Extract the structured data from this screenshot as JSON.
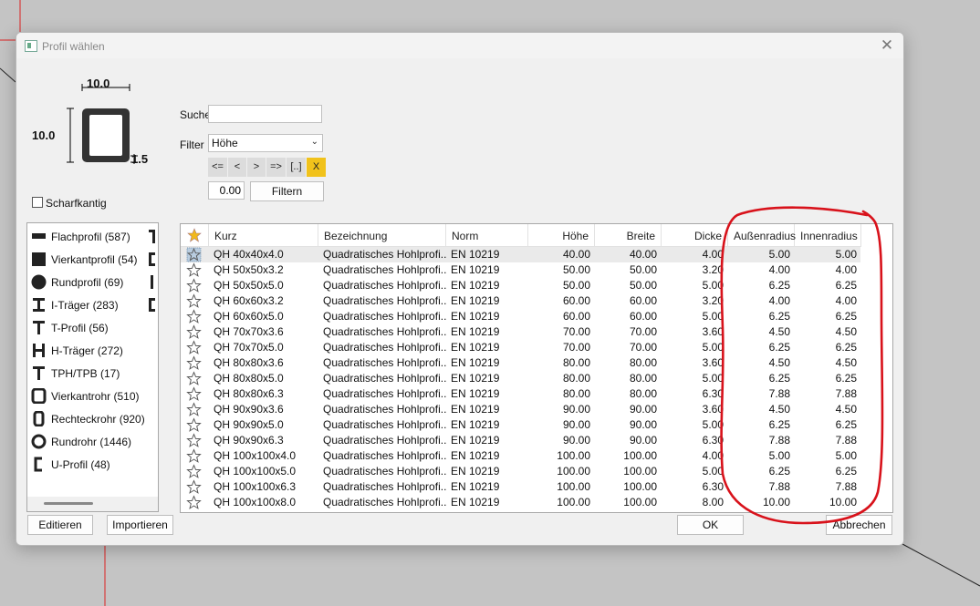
{
  "window": {
    "title": "Profil wählen",
    "close_glyph": "✕"
  },
  "preview": {
    "width": "10.0",
    "height": "10.0",
    "thickness": "1.5"
  },
  "search": {
    "label": "Suche",
    "value": ""
  },
  "filter": {
    "label": "Filter",
    "selected": "Höhe",
    "buttons": [
      "<=",
      "<",
      ">",
      "=>",
      "[..]",
      "X"
    ],
    "value": "0.00",
    "apply_label": "Filtern"
  },
  "sharp_edges": {
    "label": "Scharfkantig",
    "checked": false
  },
  "categories": [
    {
      "label": "Flachprofil (587)",
      "icon": "flat-bar-icon"
    },
    {
      "label": "Vierkantprofil (54)",
      "icon": "square-bar-icon"
    },
    {
      "label": "Rundprofil (69)",
      "icon": "round-bar-icon"
    },
    {
      "label": "I-Träger (283)",
      "icon": "i-beam-icon"
    },
    {
      "label": "T-Profil (56)",
      "icon": "t-profile-icon"
    },
    {
      "label": "H-Träger (272)",
      "icon": "h-beam-icon"
    },
    {
      "label": "TPH/TPB (17)",
      "icon": "tph-icon"
    },
    {
      "label": "Vierkantrohr (510)",
      "icon": "square-tube-icon"
    },
    {
      "label": "Rechteckrohr (920)",
      "icon": "rect-tube-icon"
    },
    {
      "label": "Rundrohr (1446)",
      "icon": "round-tube-icon"
    },
    {
      "label": "U-Profil (48)",
      "icon": "u-profile-icon"
    }
  ],
  "table": {
    "columns": [
      "Kurz",
      "Bezeichnung",
      "Norm",
      "Höhe",
      "Breite",
      "Dicke",
      "Außenradius",
      "Innenradius"
    ],
    "rows": [
      [
        "QH 40x40x4.0",
        "Quadratisches Hohlprofi...",
        "EN 10219",
        "40.00",
        "40.00",
        "4.00",
        "5.00",
        "5.00"
      ],
      [
        "QH 50x50x3.2",
        "Quadratisches Hohlprofi...",
        "EN 10219",
        "50.00",
        "50.00",
        "3.20",
        "4.00",
        "4.00"
      ],
      [
        "QH 50x50x5.0",
        "Quadratisches Hohlprofi...",
        "EN 10219",
        "50.00",
        "50.00",
        "5.00",
        "6.25",
        "6.25"
      ],
      [
        "QH 60x60x3.2",
        "Quadratisches Hohlprofi...",
        "EN 10219",
        "60.00",
        "60.00",
        "3.20",
        "4.00",
        "4.00"
      ],
      [
        "QH 60x60x5.0",
        "Quadratisches Hohlprofi...",
        "EN 10219",
        "60.00",
        "60.00",
        "5.00",
        "6.25",
        "6.25"
      ],
      [
        "QH 70x70x3.6",
        "Quadratisches Hohlprofi...",
        "EN 10219",
        "70.00",
        "70.00",
        "3.60",
        "4.50",
        "4.50"
      ],
      [
        "QH 70x70x5.0",
        "Quadratisches Hohlprofi...",
        "EN 10219",
        "70.00",
        "70.00",
        "5.00",
        "6.25",
        "6.25"
      ],
      [
        "QH 80x80x3.6",
        "Quadratisches Hohlprofi...",
        "EN 10219",
        "80.00",
        "80.00",
        "3.60",
        "4.50",
        "4.50"
      ],
      [
        "QH 80x80x5.0",
        "Quadratisches Hohlprofi...",
        "EN 10219",
        "80.00",
        "80.00",
        "5.00",
        "6.25",
        "6.25"
      ],
      [
        "QH 80x80x6.3",
        "Quadratisches Hohlprofi...",
        "EN 10219",
        "80.00",
        "80.00",
        "6.30",
        "7.88",
        "7.88"
      ],
      [
        "QH 90x90x3.6",
        "Quadratisches Hohlprofi...",
        "EN 10219",
        "90.00",
        "90.00",
        "3.60",
        "4.50",
        "4.50"
      ],
      [
        "QH 90x90x5.0",
        "Quadratisches Hohlprofi...",
        "EN 10219",
        "90.00",
        "90.00",
        "5.00",
        "6.25",
        "6.25"
      ],
      [
        "QH 90x90x6.3",
        "Quadratisches Hohlprofi...",
        "EN 10219",
        "90.00",
        "90.00",
        "6.30",
        "7.88",
        "7.88"
      ],
      [
        "QH 100x100x4.0",
        "Quadratisches Hohlprofi...",
        "EN 10219",
        "100.00",
        "100.00",
        "4.00",
        "5.00",
        "5.00"
      ],
      [
        "QH 100x100x5.0",
        "Quadratisches Hohlprofi...",
        "EN 10219",
        "100.00",
        "100.00",
        "5.00",
        "6.25",
        "6.25"
      ],
      [
        "QH 100x100x6.3",
        "Quadratisches Hohlprofi...",
        "EN 10219",
        "100.00",
        "100.00",
        "6.30",
        "7.88",
        "7.88"
      ],
      [
        "QH 100x100x8.0",
        "Quadratisches Hohlprofi...",
        "EN 10219",
        "100.00",
        "100.00",
        "8.00",
        "10.00",
        "10.00"
      ]
    ]
  },
  "buttons": {
    "edit": "Editieren",
    "import": "Importieren",
    "ok": "OK",
    "cancel": "Abbrechen"
  },
  "colors": {
    "accent_yellow": "#f1c21b",
    "annotation_red": "#d8121b"
  }
}
